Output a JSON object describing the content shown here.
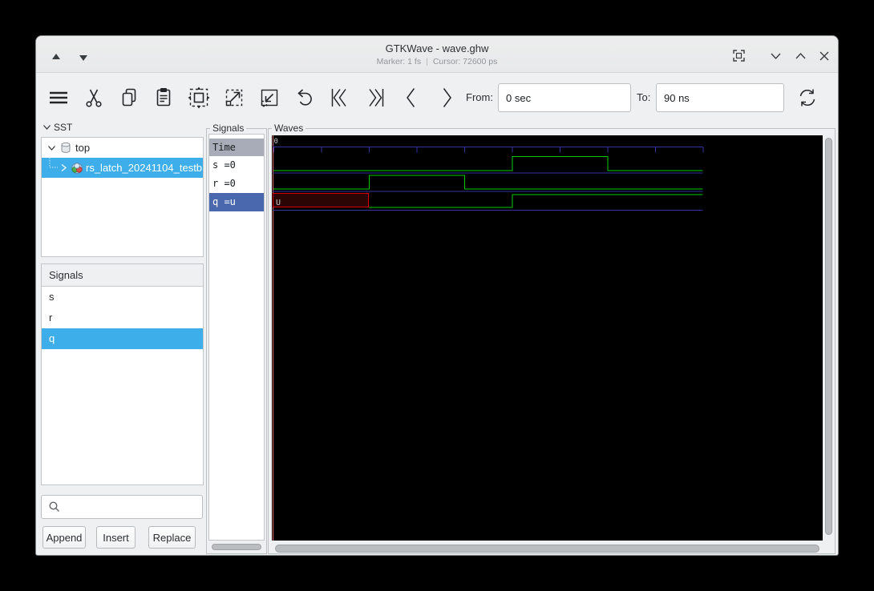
{
  "titlebar": {
    "title": "GTKWave - wave.ghw",
    "marker": "Marker: 1 fs",
    "cursor": "Cursor: 72600 ps"
  },
  "toolbar": {
    "from_label": "From:",
    "from_value": "0 sec",
    "to_label": "To:",
    "to_value": "90 ns"
  },
  "sst": {
    "label": "SST",
    "tree": [
      {
        "label": "top"
      },
      {
        "label": "rs_latch_20241104_testb"
      }
    ]
  },
  "signal_list": {
    "header": "Signals",
    "items": [
      {
        "label": "s",
        "selected": false
      },
      {
        "label": "r",
        "selected": false
      },
      {
        "label": "q",
        "selected": true
      }
    ]
  },
  "signal_values": {
    "header": "Time",
    "rows": [
      {
        "text": "s =0",
        "selected": false
      },
      {
        "text": "r =0",
        "selected": false
      },
      {
        "text": "q =u",
        "selected": true
      }
    ]
  },
  "frames": {
    "signals_label": "Signals",
    "waves_label": "Waves"
  },
  "actions": {
    "append": "Append",
    "insert": "Insert",
    "replace": "Replace"
  },
  "waves": {
    "origin_label": "0",
    "time_unit": "ns",
    "ticks_ns": [
      0,
      10,
      20,
      30,
      40,
      50,
      60,
      70,
      80,
      90
    ],
    "marker_ns": 0,
    "signals": [
      {
        "name": "s",
        "segments": [
          {
            "t0": 0,
            "t1": 50,
            "v": "0"
          },
          {
            "t0": 50,
            "t1": 70,
            "v": "1"
          },
          {
            "t0": 70,
            "t1": 90,
            "v": "0"
          }
        ]
      },
      {
        "name": "r",
        "segments": [
          {
            "t0": 0,
            "t1": 20,
            "v": "0"
          },
          {
            "t0": 20,
            "t1": 40,
            "v": "1"
          },
          {
            "t0": 40,
            "t1": 90,
            "v": "0"
          }
        ]
      },
      {
        "name": "q",
        "segments": [
          {
            "t0": 0,
            "t1": 20,
            "v": "U"
          },
          {
            "t0": 20,
            "t1": 50,
            "v": "0"
          },
          {
            "t0": 50,
            "t1": 90,
            "v": "1"
          }
        ]
      }
    ],
    "colors": {
      "signal": "#00cc00",
      "grid": "#3434a0",
      "undefined_stroke": "#dd0000",
      "undefined_fill": "#2b0404",
      "marker": "#d46a6a",
      "text": "#c8c8c8"
    }
  }
}
